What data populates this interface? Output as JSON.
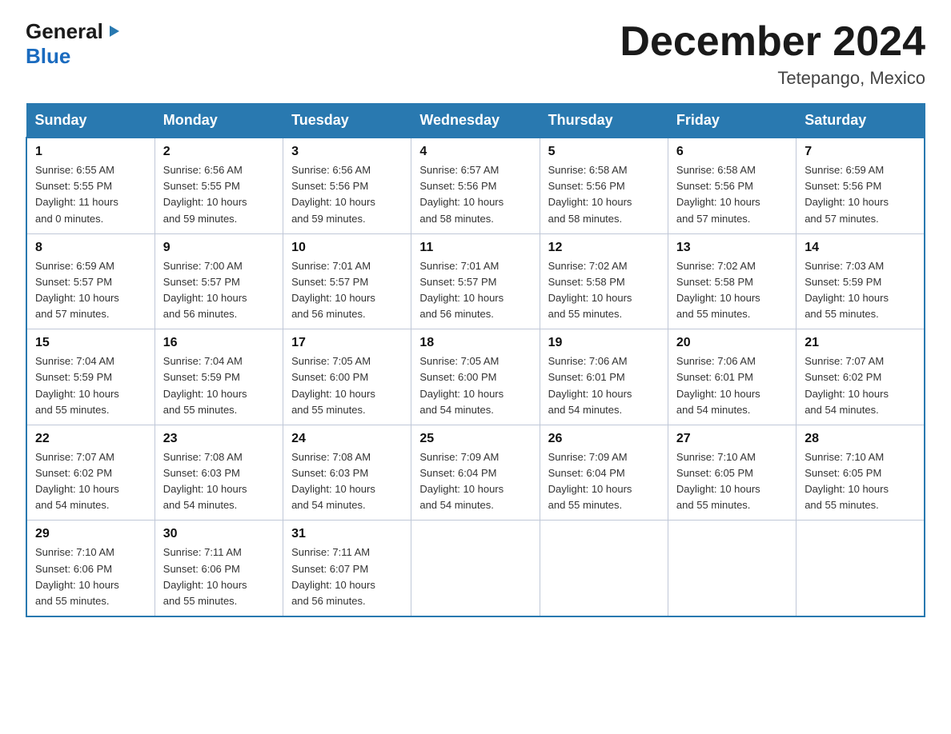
{
  "header": {
    "logo_general": "General",
    "logo_blue": "Blue",
    "calendar_title": "December 2024",
    "calendar_subtitle": "Tetepango, Mexico"
  },
  "days_of_week": [
    "Sunday",
    "Monday",
    "Tuesday",
    "Wednesday",
    "Thursday",
    "Friday",
    "Saturday"
  ],
  "weeks": [
    [
      {
        "day": "1",
        "sunrise": "6:55 AM",
        "sunset": "5:55 PM",
        "daylight": "11 hours and 0 minutes."
      },
      {
        "day": "2",
        "sunrise": "6:56 AM",
        "sunset": "5:55 PM",
        "daylight": "10 hours and 59 minutes."
      },
      {
        "day": "3",
        "sunrise": "6:56 AM",
        "sunset": "5:56 PM",
        "daylight": "10 hours and 59 minutes."
      },
      {
        "day": "4",
        "sunrise": "6:57 AM",
        "sunset": "5:56 PM",
        "daylight": "10 hours and 58 minutes."
      },
      {
        "day": "5",
        "sunrise": "6:58 AM",
        "sunset": "5:56 PM",
        "daylight": "10 hours and 58 minutes."
      },
      {
        "day": "6",
        "sunrise": "6:58 AM",
        "sunset": "5:56 PM",
        "daylight": "10 hours and 57 minutes."
      },
      {
        "day": "7",
        "sunrise": "6:59 AM",
        "sunset": "5:56 PM",
        "daylight": "10 hours and 57 minutes."
      }
    ],
    [
      {
        "day": "8",
        "sunrise": "6:59 AM",
        "sunset": "5:57 PM",
        "daylight": "10 hours and 57 minutes."
      },
      {
        "day": "9",
        "sunrise": "7:00 AM",
        "sunset": "5:57 PM",
        "daylight": "10 hours and 56 minutes."
      },
      {
        "day": "10",
        "sunrise": "7:01 AM",
        "sunset": "5:57 PM",
        "daylight": "10 hours and 56 minutes."
      },
      {
        "day": "11",
        "sunrise": "7:01 AM",
        "sunset": "5:57 PM",
        "daylight": "10 hours and 56 minutes."
      },
      {
        "day": "12",
        "sunrise": "7:02 AM",
        "sunset": "5:58 PM",
        "daylight": "10 hours and 55 minutes."
      },
      {
        "day": "13",
        "sunrise": "7:02 AM",
        "sunset": "5:58 PM",
        "daylight": "10 hours and 55 minutes."
      },
      {
        "day": "14",
        "sunrise": "7:03 AM",
        "sunset": "5:59 PM",
        "daylight": "10 hours and 55 minutes."
      }
    ],
    [
      {
        "day": "15",
        "sunrise": "7:04 AM",
        "sunset": "5:59 PM",
        "daylight": "10 hours and 55 minutes."
      },
      {
        "day": "16",
        "sunrise": "7:04 AM",
        "sunset": "5:59 PM",
        "daylight": "10 hours and 55 minutes."
      },
      {
        "day": "17",
        "sunrise": "7:05 AM",
        "sunset": "6:00 PM",
        "daylight": "10 hours and 55 minutes."
      },
      {
        "day": "18",
        "sunrise": "7:05 AM",
        "sunset": "6:00 PM",
        "daylight": "10 hours and 54 minutes."
      },
      {
        "day": "19",
        "sunrise": "7:06 AM",
        "sunset": "6:01 PM",
        "daylight": "10 hours and 54 minutes."
      },
      {
        "day": "20",
        "sunrise": "7:06 AM",
        "sunset": "6:01 PM",
        "daylight": "10 hours and 54 minutes."
      },
      {
        "day": "21",
        "sunrise": "7:07 AM",
        "sunset": "6:02 PM",
        "daylight": "10 hours and 54 minutes."
      }
    ],
    [
      {
        "day": "22",
        "sunrise": "7:07 AM",
        "sunset": "6:02 PM",
        "daylight": "10 hours and 54 minutes."
      },
      {
        "day": "23",
        "sunrise": "7:08 AM",
        "sunset": "6:03 PM",
        "daylight": "10 hours and 54 minutes."
      },
      {
        "day": "24",
        "sunrise": "7:08 AM",
        "sunset": "6:03 PM",
        "daylight": "10 hours and 54 minutes."
      },
      {
        "day": "25",
        "sunrise": "7:09 AM",
        "sunset": "6:04 PM",
        "daylight": "10 hours and 54 minutes."
      },
      {
        "day": "26",
        "sunrise": "7:09 AM",
        "sunset": "6:04 PM",
        "daylight": "10 hours and 55 minutes."
      },
      {
        "day": "27",
        "sunrise": "7:10 AM",
        "sunset": "6:05 PM",
        "daylight": "10 hours and 55 minutes."
      },
      {
        "day": "28",
        "sunrise": "7:10 AM",
        "sunset": "6:05 PM",
        "daylight": "10 hours and 55 minutes."
      }
    ],
    [
      {
        "day": "29",
        "sunrise": "7:10 AM",
        "sunset": "6:06 PM",
        "daylight": "10 hours and 55 minutes."
      },
      {
        "day": "30",
        "sunrise": "7:11 AM",
        "sunset": "6:06 PM",
        "daylight": "10 hours and 55 minutes."
      },
      {
        "day": "31",
        "sunrise": "7:11 AM",
        "sunset": "6:07 PM",
        "daylight": "10 hours and 56 minutes."
      },
      null,
      null,
      null,
      null
    ]
  ],
  "labels": {
    "sunrise": "Sunrise:",
    "sunset": "Sunset:",
    "daylight": "Daylight:"
  }
}
